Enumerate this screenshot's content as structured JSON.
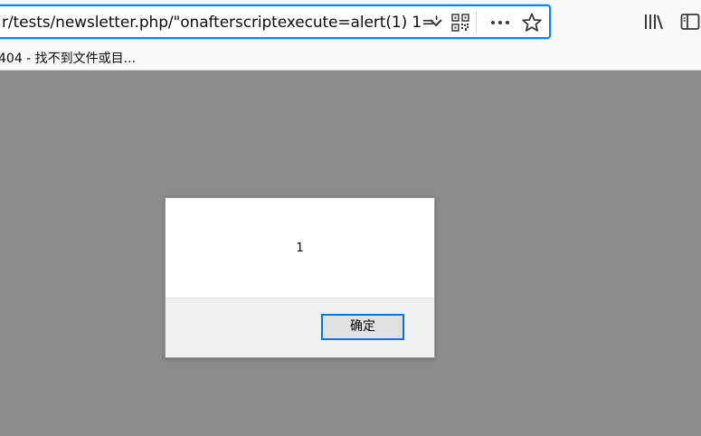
{
  "browser": {
    "url": "r/tests/newsletter.php/\"onafterscriptexecute=alert(1) 1='",
    "tab_title": "404 - 找不到文件或目...",
    "icons": {
      "dropdown": "chevron-down-icon",
      "qr": "qr-code-icon",
      "more": "more-icon",
      "bookmark": "star-icon",
      "library": "library-icon",
      "sidebar": "sidebar-icon"
    }
  },
  "dialog": {
    "message": "1",
    "ok_label": "确定"
  },
  "colors": {
    "overlay": "#8c8c8c",
    "focus_ring": "#0a84ff",
    "button_border": "#0078d7"
  }
}
